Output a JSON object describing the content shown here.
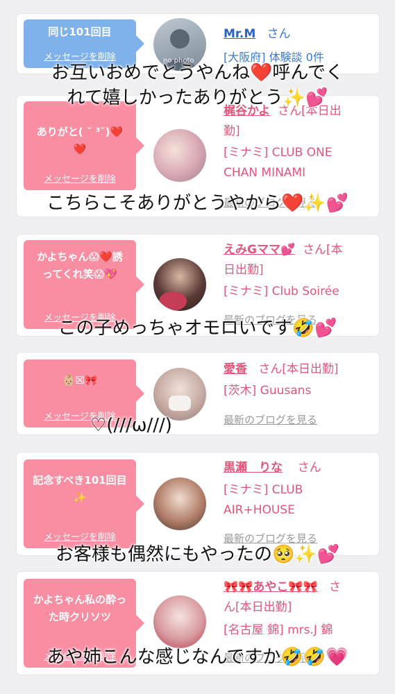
{
  "cards": [
    {
      "message": "同じ101回目",
      "delete_label": "メッセージを削除",
      "avatar_text": "no photo",
      "name": "Mr.M",
      "san": "さん",
      "shop_line1": "[大阪府] 体験談 0件",
      "shop_line2": ""
    },
    {
      "message": "ありがと( ˘ ³˘)❤️❤️",
      "delete_label": "メッセージを削除",
      "name": "梶谷かよ",
      "san": "さん[本日出",
      "name_line2": "勤]",
      "shop_line1": "[ミナミ] CLUB ONE",
      "shop_line2": "CHAN MINAMI",
      "blog": "最新のブログを見る"
    },
    {
      "message": "かよちゃん😱❤️誘ってくれ笑😱💖",
      "delete_label": "メッセージを削除",
      "name": "えみGママ💕",
      "san": "さん[本",
      "name_line2": "日出勤]",
      "shop_line1": "[ミナミ] Club Soirée",
      "blog": "最新のブログを見る"
    },
    {
      "message": "👶🏼☒🎀",
      "delete_label": "メッセージを削除",
      "name": "愛香",
      "san": "さん[本日出勤]",
      "shop_line1": "[茨木] Guusans",
      "blog": "最新のブログを見る"
    },
    {
      "message": "記念すべき101回目✨",
      "delete_label": "メッセージを削除",
      "name": "黒瀬　りな",
      "san": "さん",
      "shop_line1": "[ミナミ] CLUB",
      "shop_line2": "AIR+HOUSE",
      "blog": "最新のブログを見る"
    },
    {
      "message": "かよちゃん私の酔った時クリソツ",
      "delete_label": "メッセージを削除",
      "name": "🎀🎀あやこ🎀🎀",
      "san": "さ",
      "name_line2": "ん[本日出勤]",
      "shop_line1": "[名古屋 錦] mrs.J 錦",
      "blog": "最新のブログを見る"
    }
  ],
  "overlays": {
    "o1_line1": "お互いおめでとうやんね❤️呼んでく",
    "o1_line2": "れて嬉しかったありがとう✨💕",
    "o2": "こちらこそありがとうやから❤️✨💕",
    "o3": "この子めっちゃオモロいです🤣💕",
    "o4": "♡(///ω///)",
    "o5": "お客様も偶然にもやったの🥺✨💕",
    "o6": "あや姉こんな感じなんですか🤣🤣💗"
  },
  "colors": {
    "bubble_pink": "#f98ea3",
    "bubble_blue": "#7fb1ea",
    "name_pink": "#e2567b",
    "name_blue": "#3b78cf"
  }
}
